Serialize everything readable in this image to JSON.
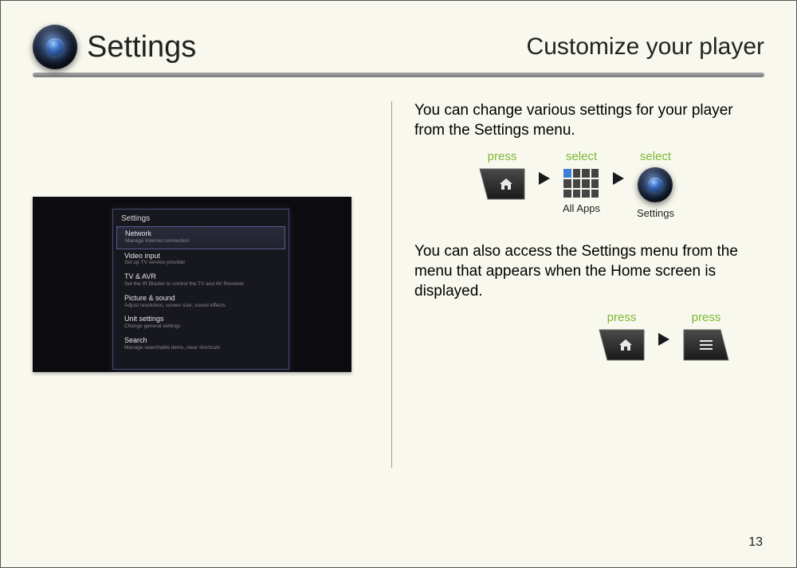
{
  "header": {
    "title": "Settings",
    "subtitle": "Customize your player"
  },
  "intro": "You can change various settings for your player from the Settings menu.",
  "nav1": {
    "step1_label": "press",
    "step2_label": "select",
    "step2_caption": "All Apps",
    "step3_label": "select",
    "step3_caption": "Settings"
  },
  "intro2": "You can also access the Settings menu from the menu that appears when the Home screen is displayed.",
  "nav2": {
    "step1_label": "press",
    "step2_label": "press"
  },
  "screenshot": {
    "panel_title": "Settings",
    "items": [
      {
        "title": "Network",
        "sub": "Manage Internet connection",
        "selected": true
      },
      {
        "title": "Video input",
        "sub": "Set up TV service provider",
        "selected": false
      },
      {
        "title": "TV & AVR",
        "sub": "Set the IR Blaster to control the TV and AV Receiver",
        "selected": false
      },
      {
        "title": "Picture & sound",
        "sub": "Adjust resolution, screen size, sound effects",
        "selected": false
      },
      {
        "title": "Unit settings",
        "sub": "Change general settings",
        "selected": false
      },
      {
        "title": "Search",
        "sub": "Manage searchable items, clear shortcuts",
        "selected": false
      }
    ]
  },
  "page_number": "13"
}
